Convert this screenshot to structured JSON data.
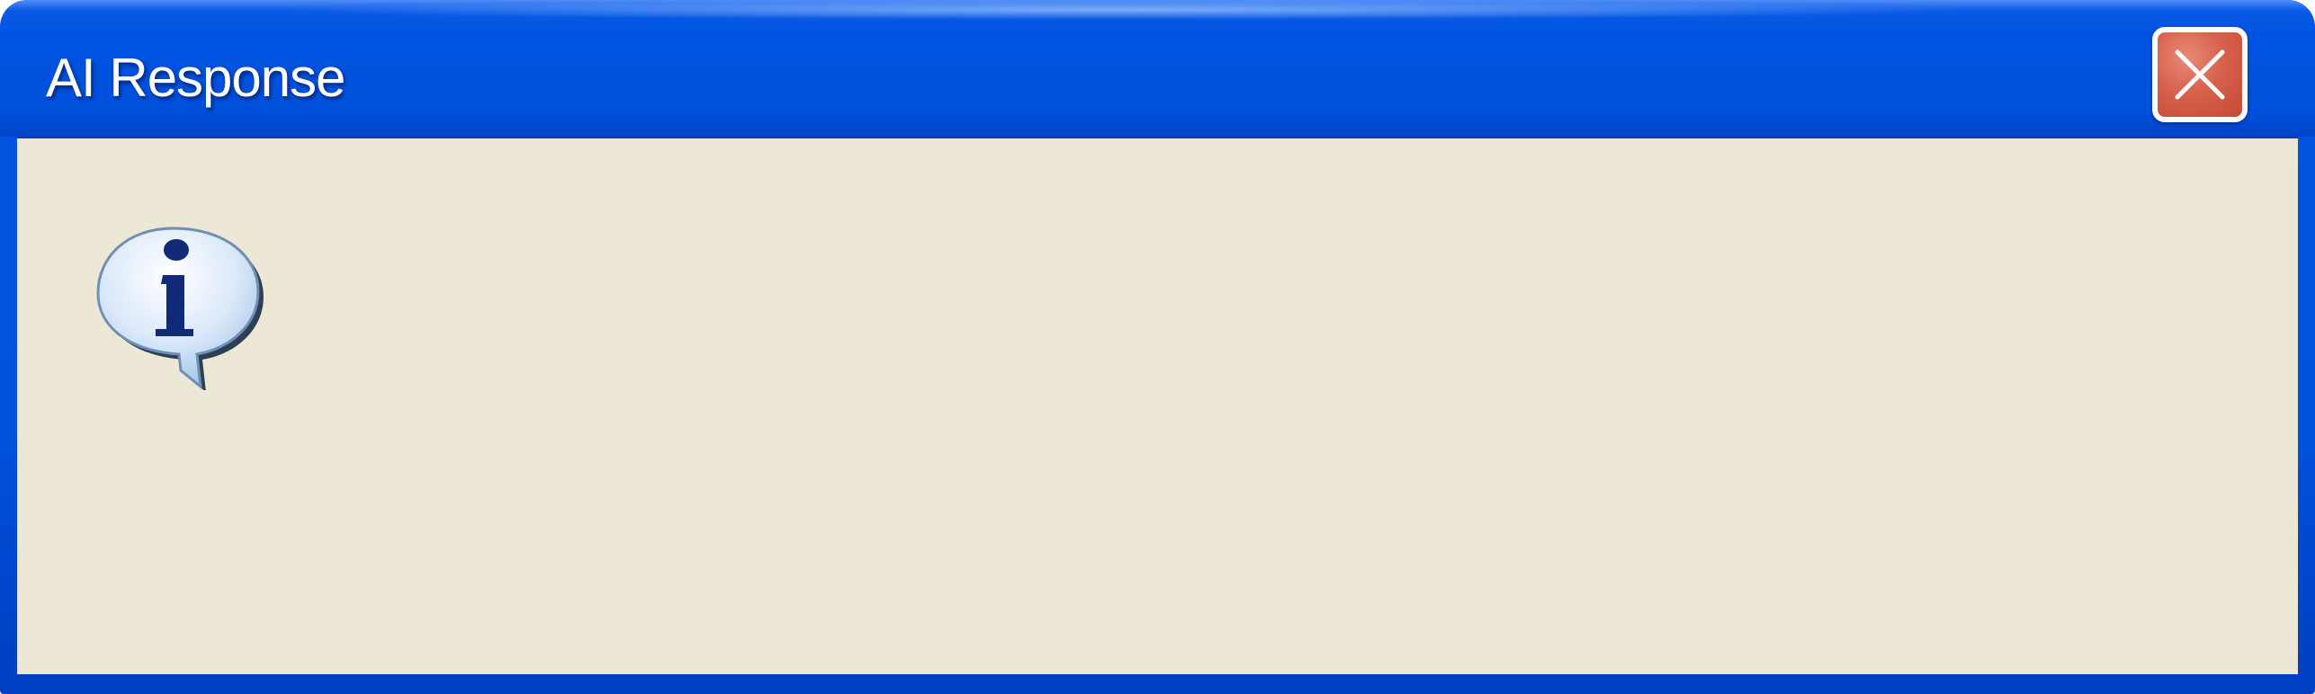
{
  "window": {
    "title": "AI Response",
    "close_icon": "close-icon",
    "colors": {
      "titlebar": "#0052de",
      "body": "#ede7d6",
      "close_button": "#d6614c"
    }
  },
  "content": {
    "icon": "info-icon",
    "message": ""
  }
}
